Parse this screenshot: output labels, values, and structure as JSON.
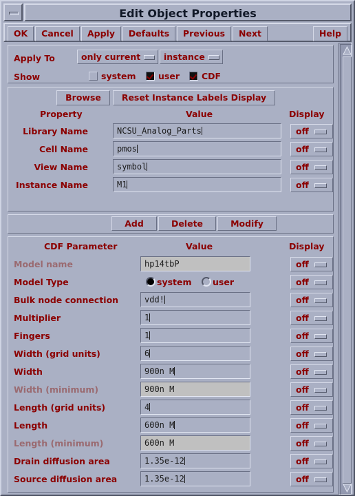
{
  "window": {
    "title": "Edit Object Properties",
    "minimize_icon": "minimize-icon"
  },
  "actionbar": {
    "buttons": [
      {
        "label": "OK",
        "name": "ok-button"
      },
      {
        "label": "Cancel",
        "name": "cancel-button"
      },
      {
        "label": "Apply",
        "name": "apply-button"
      },
      {
        "label": "Defaults",
        "name": "defaults-button"
      },
      {
        "label": "Previous",
        "name": "previous-button"
      },
      {
        "label": "Next",
        "name": "next-button"
      }
    ],
    "help_label": "Help"
  },
  "apply_section": {
    "apply_to_label": "Apply To",
    "apply_to_options": [
      {
        "value": "only current"
      },
      {
        "value": "instance"
      }
    ],
    "show_label": "Show",
    "show_options": [
      {
        "label": "system",
        "checked": false
      },
      {
        "label": "user",
        "checked": true
      },
      {
        "label": "CDF",
        "checked": true
      }
    ]
  },
  "property_section": {
    "browse_label": "Browse",
    "reset_label": "Reset Instance Labels Display",
    "columns": {
      "property": "Property",
      "value": "Value",
      "display": "Display"
    },
    "rows": [
      {
        "label": "Library Name",
        "value": "NCSU_Analog_Parts",
        "display": "off",
        "readonly": false,
        "caret": true
      },
      {
        "label": "Cell Name",
        "value": "pmos",
        "display": "off",
        "readonly": false,
        "caret": true
      },
      {
        "label": "View Name",
        "value": "symbol",
        "display": "off",
        "readonly": false,
        "caret": true
      },
      {
        "label": "Instance Name",
        "value": "M1",
        "display": "off",
        "readonly": false,
        "caret": true
      }
    ]
  },
  "cdf_section": {
    "buttons": [
      {
        "label": "Add",
        "name": "add-button"
      },
      {
        "label": "Delete",
        "name": "delete-button"
      },
      {
        "label": "Modify",
        "name": "modify-button"
      }
    ],
    "columns": {
      "parameter": "CDF Parameter",
      "value": "Value",
      "display": "Display"
    },
    "rows": [
      {
        "label": "Model name",
        "value": "hp14tbP",
        "display": "off",
        "readonly": true,
        "disabled": true,
        "caret": false,
        "type": "text"
      },
      {
        "label": "Model Type",
        "display": "off",
        "type": "radio",
        "radio_options": [
          {
            "label": "system",
            "selected": true
          },
          {
            "label": "user",
            "selected": false
          }
        ]
      },
      {
        "label": "Bulk node connection",
        "value": "vdd!",
        "display": "off",
        "readonly": false,
        "disabled": false,
        "caret": true,
        "type": "text"
      },
      {
        "label": "Multiplier",
        "value": "1",
        "display": "off",
        "readonly": false,
        "disabled": false,
        "caret": true,
        "type": "text"
      },
      {
        "label": "Fingers",
        "value": "1",
        "display": "off",
        "readonly": false,
        "disabled": false,
        "caret": true,
        "type": "text"
      },
      {
        "label": "Width (grid units)",
        "value": "6",
        "display": "off",
        "readonly": false,
        "disabled": false,
        "caret": true,
        "type": "text"
      },
      {
        "label": "Width",
        "value": "900n M",
        "display": "off",
        "readonly": false,
        "disabled": false,
        "caret": true,
        "type": "text"
      },
      {
        "label": "Width (minimum)",
        "value": "900n M",
        "display": "off",
        "readonly": true,
        "disabled": true,
        "caret": false,
        "type": "text"
      },
      {
        "label": "Length (grid units)",
        "value": "4",
        "display": "off",
        "readonly": false,
        "disabled": false,
        "caret": true,
        "type": "text"
      },
      {
        "label": "Length",
        "value": "600n M",
        "display": "off",
        "readonly": false,
        "disabled": false,
        "caret": true,
        "type": "text"
      },
      {
        "label": "Length (minimum)",
        "value": "600n M",
        "display": "off",
        "readonly": true,
        "disabled": true,
        "caret": false,
        "type": "text"
      },
      {
        "label": "Drain diffusion area",
        "value": "1.35e-12",
        "display": "off",
        "readonly": false,
        "disabled": false,
        "caret": true,
        "type": "text"
      },
      {
        "label": "Source diffusion area",
        "value": "1.35e-12",
        "display": "off",
        "readonly": false,
        "disabled": false,
        "caret": true,
        "type": "text"
      }
    ]
  },
  "scrollbar": {
    "up_icon": "scroll-up-arrow-icon",
    "down_icon": "scroll-down-arrow-icon"
  },
  "colors": {
    "dialog_bg": "#aab0c4",
    "label_red": "#8b0000",
    "disabled_field": "#c0c0c0",
    "title_text": "#111827"
  }
}
